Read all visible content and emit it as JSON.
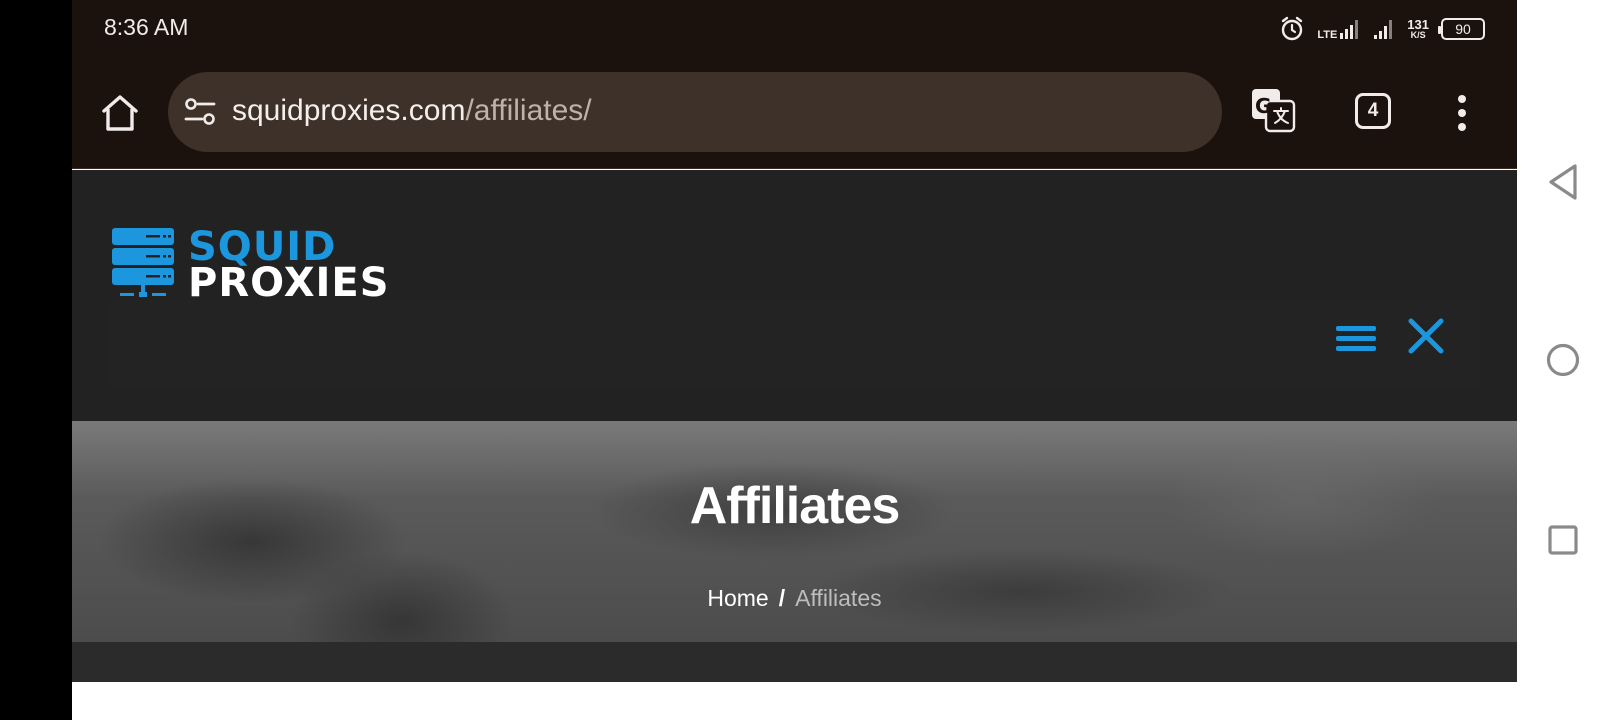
{
  "status_bar": {
    "time": "8:36 AM",
    "network_label": "LTE",
    "speed_value": "131",
    "speed_unit": "K/S",
    "battery": "90"
  },
  "browser": {
    "url_domain": "squidproxies.com",
    "url_path": "/affiliates/",
    "tab_count": "4",
    "icons": {
      "home": "home-icon",
      "site_settings": "tune-icon",
      "translate": "translate-icon",
      "menu": "more-vertical-icon"
    }
  },
  "site": {
    "logo": {
      "line1": "SQUID",
      "line2": "PROXIES"
    },
    "hero": {
      "title": "Affiliates"
    },
    "breadcrumb": {
      "home": "Home",
      "separator": "/",
      "current": "Affiliates"
    },
    "colors": {
      "brand_blue": "#1c97de",
      "header_bg": "#222222",
      "browser_bg": "#1b120e",
      "urlbar_bg": "#3e312a"
    }
  },
  "system_nav": {
    "icons": [
      "back-icon",
      "home-circle-icon",
      "recents-icon"
    ]
  }
}
